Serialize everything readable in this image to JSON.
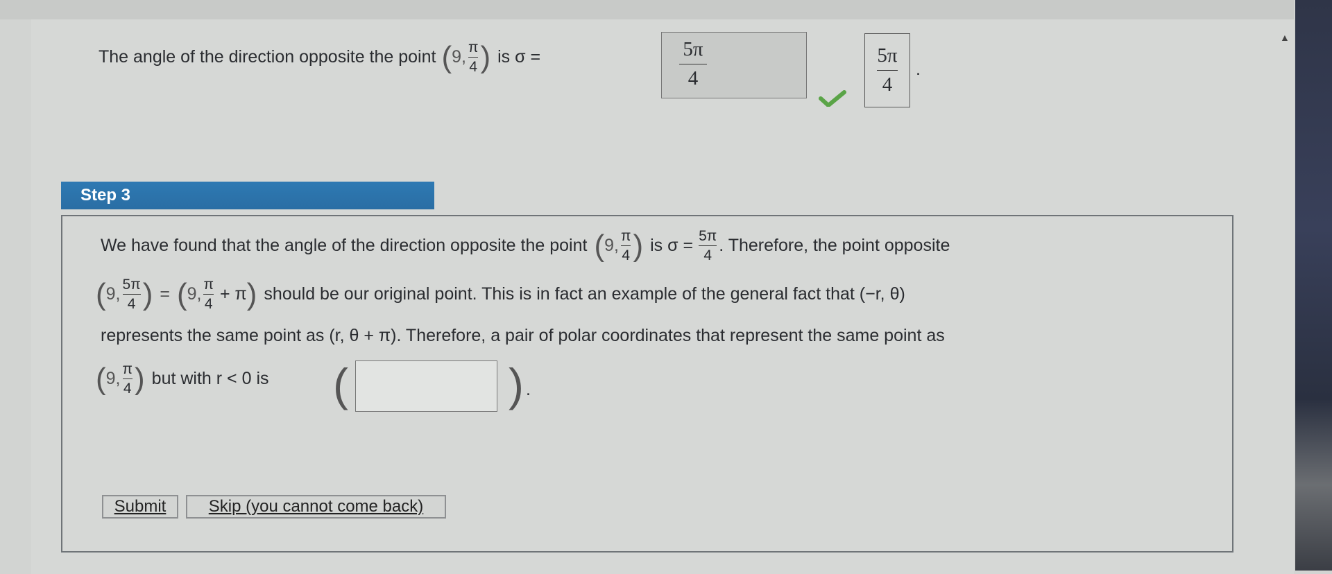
{
  "question": {
    "prefix": "The angle of the direction opposite the point",
    "point_r": "9,",
    "point_num": "π",
    "point_den": "4",
    "is_sigma": "is σ =",
    "answer_num": "5π",
    "answer_den": "4",
    "correct_num": "5π",
    "correct_den": "4",
    "period": "."
  },
  "step": {
    "title": "Step 3",
    "line1_prefix": "We have found that the angle of the direction opposite the point",
    "line1_point_r": "9,",
    "line1_point_num": "π",
    "line1_point_den": "4",
    "line1_is_sigma": "is σ =",
    "line1_sigma_num": "5π",
    "line1_sigma_den": "4",
    "line1_suffix": ". Therefore, the point opposite",
    "line2_a_r": "9,",
    "line2_a_num": "5π",
    "line2_a_den": "4",
    "line2_equals": "=",
    "line2_b_r": "9,",
    "line2_b_num": "π",
    "line2_b_den": "4",
    "line2_b_plus": "+ π",
    "line2_suffix": "should be our original point. This is in fact an example of the general fact that (−r, θ)",
    "line3": "represents the same point as (r, θ + π). Therefore, a pair of polar coordinates that represent the same point as",
    "line4_r": "9,",
    "line4_num": "π",
    "line4_den": "4",
    "line4_mid": "but with r < 0 is",
    "line4_end": "."
  },
  "buttons": {
    "submit": "Submit",
    "skip": "Skip (you cannot come back)"
  },
  "input": {
    "value": ""
  },
  "colors": {
    "step_bar": "#2e79b3",
    "check": "#5aa447"
  }
}
